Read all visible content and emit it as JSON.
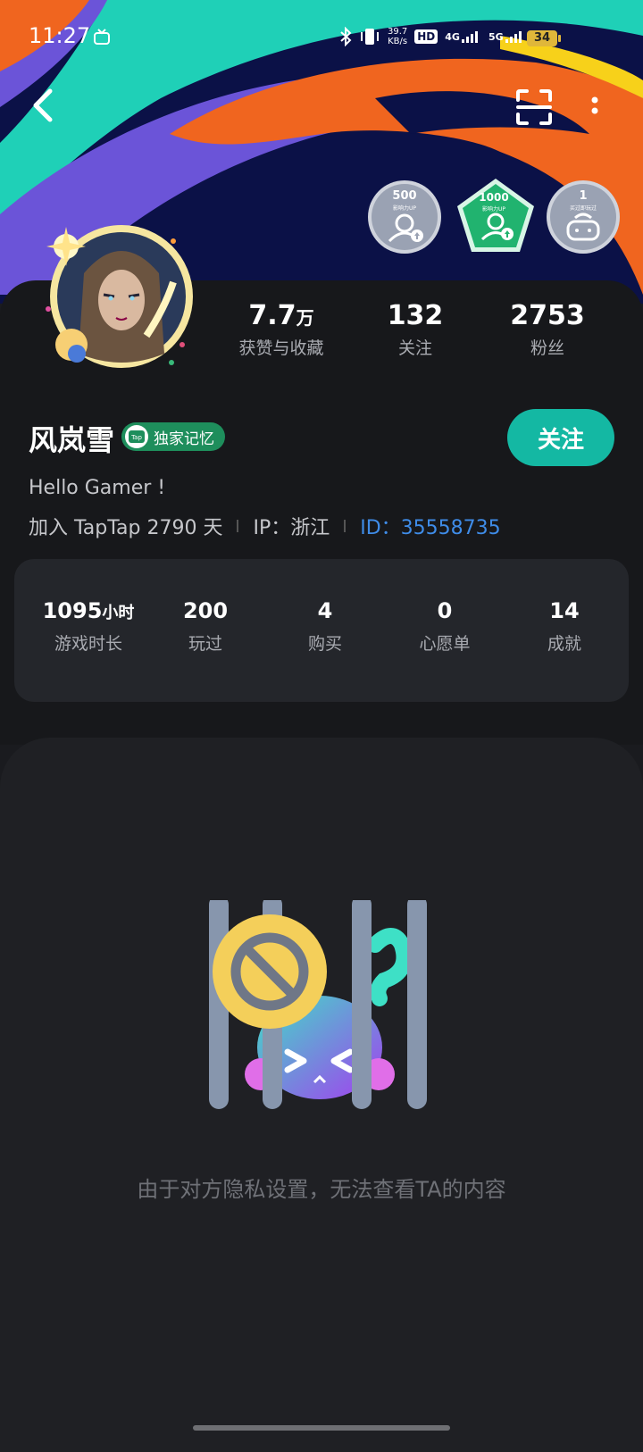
{
  "status_bar": {
    "time": "11:27",
    "net_speed_value": "39.7",
    "net_speed_unit": "KB/s",
    "hd": "HD",
    "sim1": "4G",
    "sim2": "5G",
    "battery": "34"
  },
  "nav": {
    "back_icon": "back-chevron-icon",
    "scan_icon": "scan-icon",
    "more_icon": "more-vertical-icon"
  },
  "badges": [
    {
      "value": "500",
      "caption": "影响力UP",
      "icon": "user-up-icon",
      "color": "#9aa2b3"
    },
    {
      "value": "1000",
      "caption": "影响力UP",
      "icon": "user-up-icon",
      "color": "#21b36f"
    },
    {
      "value": "1",
      "caption": "买过即玩过",
      "icon": "gamepad-icon",
      "color": "#9aa2b3"
    }
  ],
  "profile": {
    "stats": [
      {
        "value": "7.7",
        "unit": "万",
        "label": "获赞与收藏"
      },
      {
        "value": "132",
        "label": "关注"
      },
      {
        "value": "2753",
        "label": "粉丝"
      }
    ],
    "username": "风岚雪",
    "tag": "独家记忆",
    "tag_icon_text": "Tap",
    "follow_label": "关注",
    "bio": "Hello Gamer !",
    "joined": "加入 TapTap 2790 天",
    "ip": "IP：浙江",
    "id": "ID：35558735"
  },
  "game_stats": [
    {
      "value": "1095",
      "unit": "小时",
      "label": "游戏时长"
    },
    {
      "value": "200",
      "label": "玩过"
    },
    {
      "value": "4",
      "label": "购买"
    },
    {
      "value": "0",
      "label": "心愿单"
    },
    {
      "value": "14",
      "label": "成就"
    }
  ],
  "privacy_message": "由于对方隐私设置，无法查看TA的内容",
  "colors": {
    "accent": "#14b8a3",
    "id_link": "#3f8ce8",
    "tag_green": "#1e8e5c"
  }
}
